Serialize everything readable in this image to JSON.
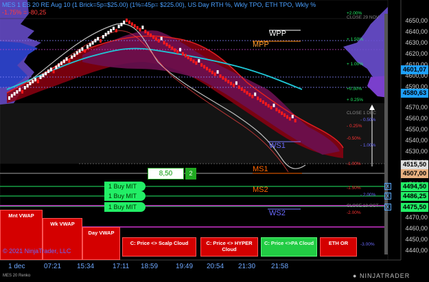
{
  "header": {
    "line1": "MES 1 ES 20 RE Aug 10 (1 Brick=5p=$25.00) (1%=45p= $225.00), US Day RTH %, Wkly TPO, ETH TPO, Wkly %",
    "line2": "-1.75% = -80,25"
  },
  "price_axis": {
    "labels": [
      "4650,00",
      "4640,00",
      "4630,00",
      "4620,00",
      "4610,00",
      "4600,00",
      "4590,00",
      "4570,00",
      "4560,00",
      "4550,00",
      "4540,00",
      "4530,00",
      "4520,00",
      "4510,00",
      "4500,00",
      "4490,00",
      "4480,00",
      "4470,00",
      "4460,00",
      "4450,00",
      "4440,00"
    ],
    "tags": [
      {
        "text": "4601,07",
        "color": "#1ea0ff",
        "fg": "#000"
      },
      {
        "text": "4580,63",
        "color": "#1ea0ff",
        "fg": "#000"
      },
      {
        "text": "4515,50",
        "color": "#dddddd",
        "fg": "#000"
      },
      {
        "text": "4507,00",
        "color": "#e8b080",
        "fg": "#000"
      },
      {
        "text": "4494,50",
        "color": "#22ee66",
        "fg": "#000"
      },
      {
        "text": "4486,25",
        "color": "#22ee66",
        "fg": "#000"
      },
      {
        "text": "4475,50",
        "color": "#22ee66",
        "fg": "#000"
      }
    ]
  },
  "time_axis": [
    "1 dec",
    "07:21",
    "15:34",
    "17:11",
    "18:59",
    "19:49",
    "20:54",
    "21:30",
    "21:58"
  ],
  "levels": {
    "wpp": "WPP",
    "mpp": "MPP",
    "ws1": "WS1",
    "ms1": "MS1",
    "ws2": "WS2",
    "ms2": "MS2"
  },
  "pct_labels": {
    "close_nov": "CLOSE 29 NOV",
    "close_dec": "CLOSE 1 DEC",
    "close_oct": "CLOSE 18 OCT",
    "p200": "+2.00%",
    "p150": "+ 1.50%",
    "p100": "+ 1.00%",
    "p050": "+0.50%",
    "p025": "+ 0.25%",
    "m050a": "- 0.50%",
    "m025": "- 0.25%",
    "m050b": "-0.50%",
    "m100a": "- 1.00%",
    "m100b": "-1.00%",
    "m150": "-1.50%",
    "m200a": "- 2.00%",
    "m200b": "-2.00%",
    "m300": "-3.00%"
  },
  "order_entry": {
    "quantity": "8,50",
    "account_num": "2"
  },
  "orders": [
    "1 Buy MIT",
    "1 Buy MIT",
    "1 Buy MIT"
  ],
  "order_close": "X",
  "buttons": {
    "mnt_vwap": "Mnt VWAP",
    "wk_vwap": "Wk VWAP",
    "day_vwap": "Day VWAP",
    "scalp": "C: Price <> Scalp Cloud",
    "hyper": "C: Price <> HYPER Cloud",
    "pa": "C: Price <>PA Cloud",
    "eth": "ETH OR"
  },
  "footer": {
    "copyright": "© 2021 NinjaTrader, LLC",
    "instrument": "MES 20 Renko",
    "brand": "NINJATRADER"
  },
  "colors": {
    "accent_blue": "#1ea0ff",
    "buy_green": "#22ee66",
    "cloud_red": "#cc0000",
    "cloud_purple": "#7a1a4a",
    "teal_ma": "#20c8d8"
  }
}
